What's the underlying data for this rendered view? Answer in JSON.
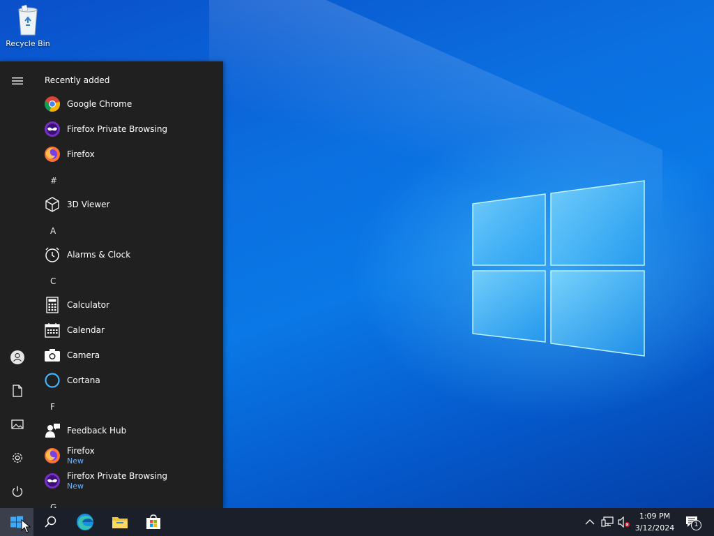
{
  "desktop": {
    "icons": [
      {
        "label": "Recycle Bin",
        "icon": "recycle-bin-icon"
      }
    ]
  },
  "start_menu": {
    "section_title": "Recently added",
    "recent": [
      {
        "name": "Google Chrome",
        "icon": "chrome-icon"
      },
      {
        "name": "Firefox Private Browsing",
        "icon": "firefox-private-icon"
      },
      {
        "name": "Firefox",
        "icon": "firefox-icon"
      }
    ],
    "groups": [
      {
        "letter": "#",
        "apps": [
          {
            "name": "3D Viewer",
            "icon": "cube-icon"
          }
        ]
      },
      {
        "letter": "A",
        "apps": [
          {
            "name": "Alarms & Clock",
            "icon": "alarm-clock-icon"
          }
        ]
      },
      {
        "letter": "C",
        "apps": [
          {
            "name": "Calculator",
            "icon": "calculator-icon"
          },
          {
            "name": "Calendar",
            "icon": "calendar-icon"
          },
          {
            "name": "Camera",
            "icon": "camera-icon"
          },
          {
            "name": "Cortana",
            "icon": "cortana-icon"
          }
        ]
      },
      {
        "letter": "F",
        "apps": [
          {
            "name": "Feedback Hub",
            "icon": "feedback-icon"
          },
          {
            "name": "Firefox",
            "sub": "New",
            "icon": "firefox-icon"
          },
          {
            "name": "Firefox Private Browsing",
            "sub": "New",
            "icon": "firefox-private-icon"
          }
        ]
      },
      {
        "letter": "G",
        "apps": []
      }
    ],
    "rail": [
      "menu-icon",
      "user-icon",
      "document-icon",
      "pictures-icon",
      "settings-icon",
      "power-icon"
    ]
  },
  "taskbar": {
    "apps": [
      "start-icon",
      "search-icon",
      "edge-icon",
      "file-explorer-icon",
      "store-icon"
    ],
    "tray": [
      "chevron-up-icon",
      "network-icon",
      "volume-muted-icon"
    ],
    "time": "1:09 PM",
    "date": "3/12/2024",
    "notification_count": "1"
  },
  "colors": {
    "menu_bg": "#202020",
    "taskbar_bg": "#1b1f2a",
    "accent_sub": "#6db4ff"
  }
}
